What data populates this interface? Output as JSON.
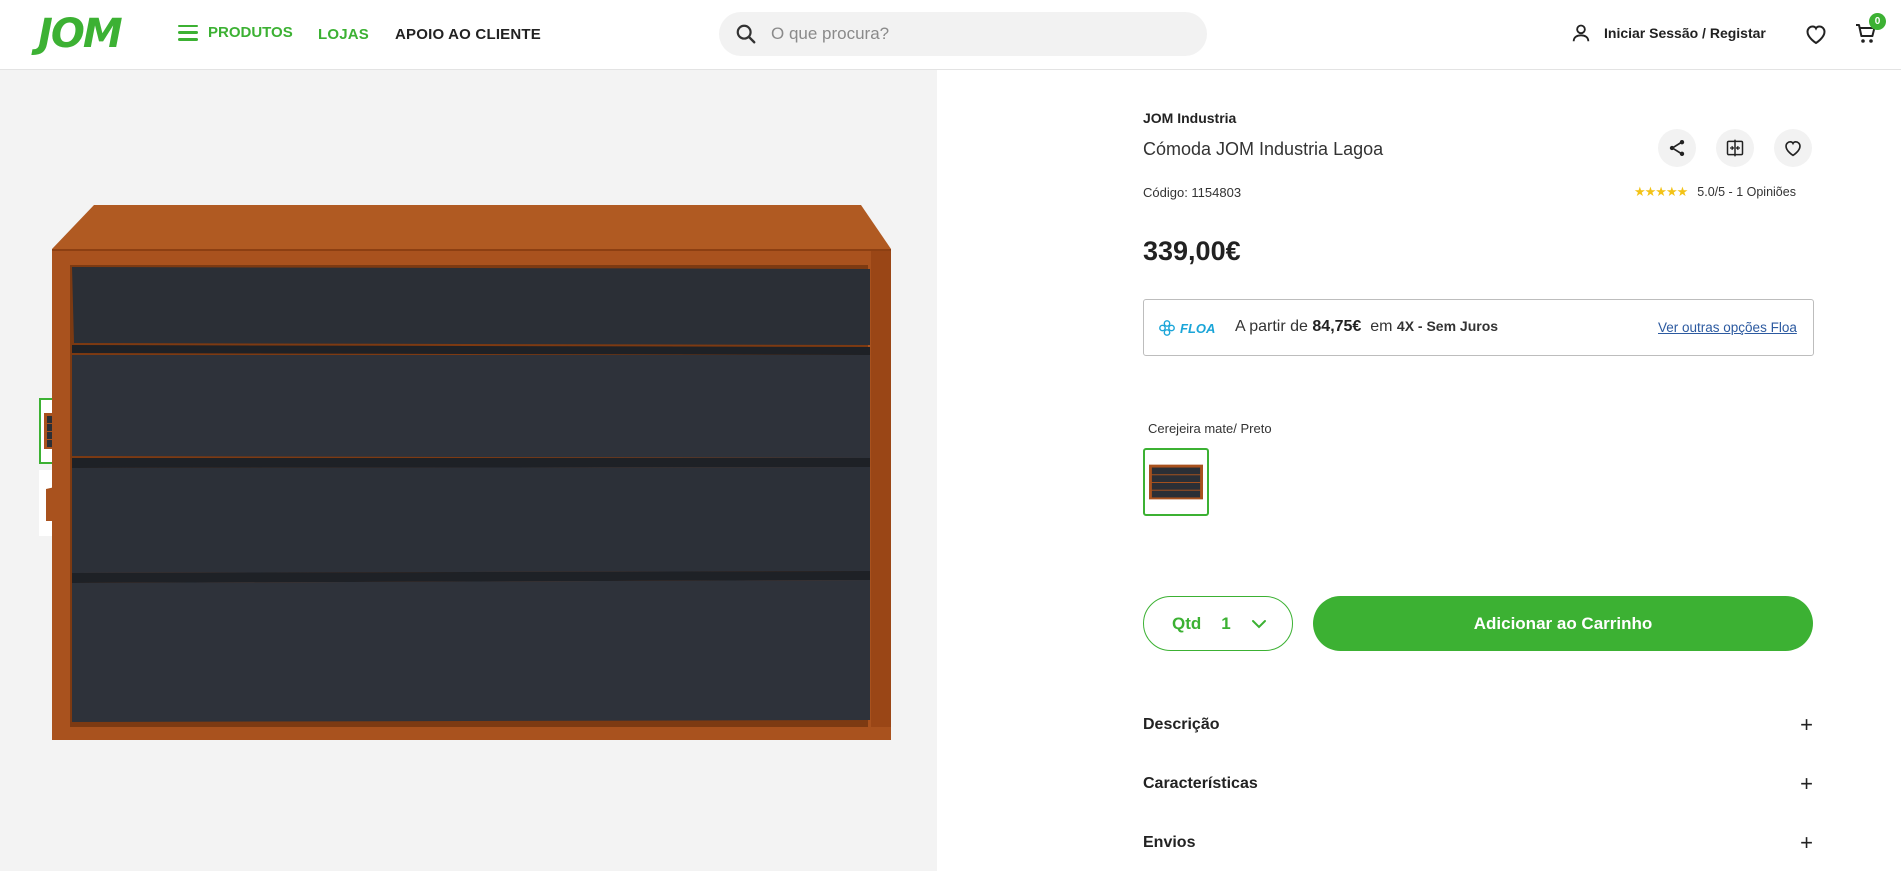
{
  "header": {
    "logo": "JOM",
    "menu_label": "PRODUTOS",
    "stores_label": "LOJAS",
    "support_label": "APOIO AO CLIENTE",
    "search_placeholder": "O que procura?",
    "login_label": "Iniciar Sessão / Registar",
    "cart_count": "0",
    "accent_color": "#3cb133"
  },
  "product": {
    "brand": "JOM Industria",
    "title": "Cómoda JOM Industria Lagoa",
    "code": "Código: 1154803",
    "rating_stars": "★★★★★",
    "rating_text": "5.0/5 - 1 Opiniões",
    "rating_value": 5.0,
    "price": "339,00€",
    "floa": {
      "logo": "FLOA",
      "prefix": "A partir de",
      "amount": "84,75€",
      "middle": "em",
      "installments": "4X - Sem Juros",
      "link": "Ver outras opções Floa"
    },
    "variant_label": "Cerejeira mate/ Preto",
    "qty_label": "Qtd",
    "qty_value": "1",
    "add_to_cart": "Adicionar ao Carrinho",
    "accordions": [
      "Descrição",
      "Características",
      "Envios"
    ]
  },
  "gallery": {
    "thumbnail_count": 2,
    "active_index": 0,
    "wood_color": "#a9521e",
    "drawer_color": "#2b2f36"
  }
}
